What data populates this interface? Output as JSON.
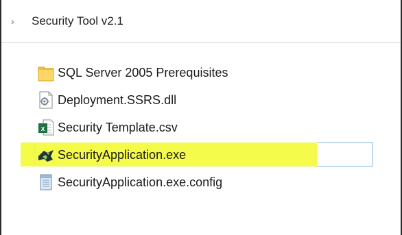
{
  "address_bar": {
    "chevron": "›",
    "breadcrumb": "Security Tool v2.1"
  },
  "files": [
    {
      "name": "SQL Server 2005 Prerequisites",
      "icon": "folder-icon"
    },
    {
      "name": "Deployment.SSRS.dll",
      "icon": "dll-file-icon"
    },
    {
      "name": "Security Template.csv",
      "icon": "excel-csv-icon"
    },
    {
      "name": "SecurityApplication.exe",
      "icon": "application-exe-icon",
      "selected": true,
      "highlight_color": "#f4fb3c"
    },
    {
      "name": "SecurityApplication.exe.config",
      "icon": "config-file-icon"
    }
  ],
  "colors": {
    "selection_border": "#7eb4ea",
    "highlight": "#f4fb3c",
    "folder": "#f7c948",
    "excel": "#1e7145"
  }
}
